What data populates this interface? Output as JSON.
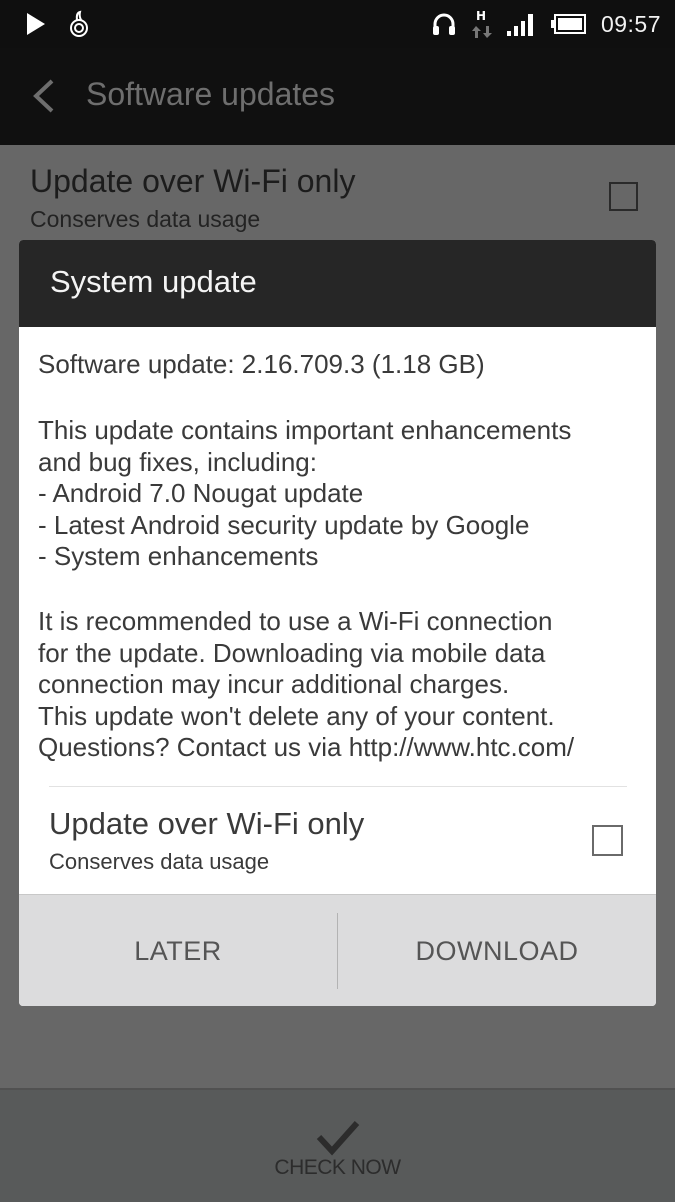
{
  "status_bar": {
    "icons_left": [
      "play-icon",
      "htc-notification-icon"
    ],
    "icons_right": [
      "headphones-icon",
      "hspa-data-icon",
      "signal-icon",
      "battery-icon"
    ],
    "network_type": "H",
    "time": "09:57"
  },
  "app_bar": {
    "back_icon": "chevron-left-icon",
    "title": "Software updates"
  },
  "background_preference": {
    "title": "Update over Wi-Fi only",
    "subtitle": "Conserves data usage",
    "checked": false
  },
  "dialog": {
    "title": "System update",
    "version_line": "Software update: 2.16.709.3 (1.18 GB)",
    "description_lines": [
      "This update contains important enhancements",
      "and bug fixes, including:",
      "- Android 7.0 Nougat update",
      "- Latest Android security update by Google",
      "- System enhancements"
    ],
    "notice_lines": [
      "It is recommended to use a Wi-Fi connection",
      "for the update. Downloading via mobile data",
      "connection may incur additional charges.",
      "This update won't delete any of your content.",
      "Questions? Contact us via http://www.htc.com/"
    ],
    "wifi_preference": {
      "title": "Update over Wi-Fi only",
      "subtitle": "Conserves data usage",
      "checked": false
    },
    "buttons": {
      "later": "LATER",
      "download": "DOWNLOAD"
    }
  },
  "bottom_bar": {
    "icon": "checkmark-icon",
    "label": "CHECK NOW"
  }
}
